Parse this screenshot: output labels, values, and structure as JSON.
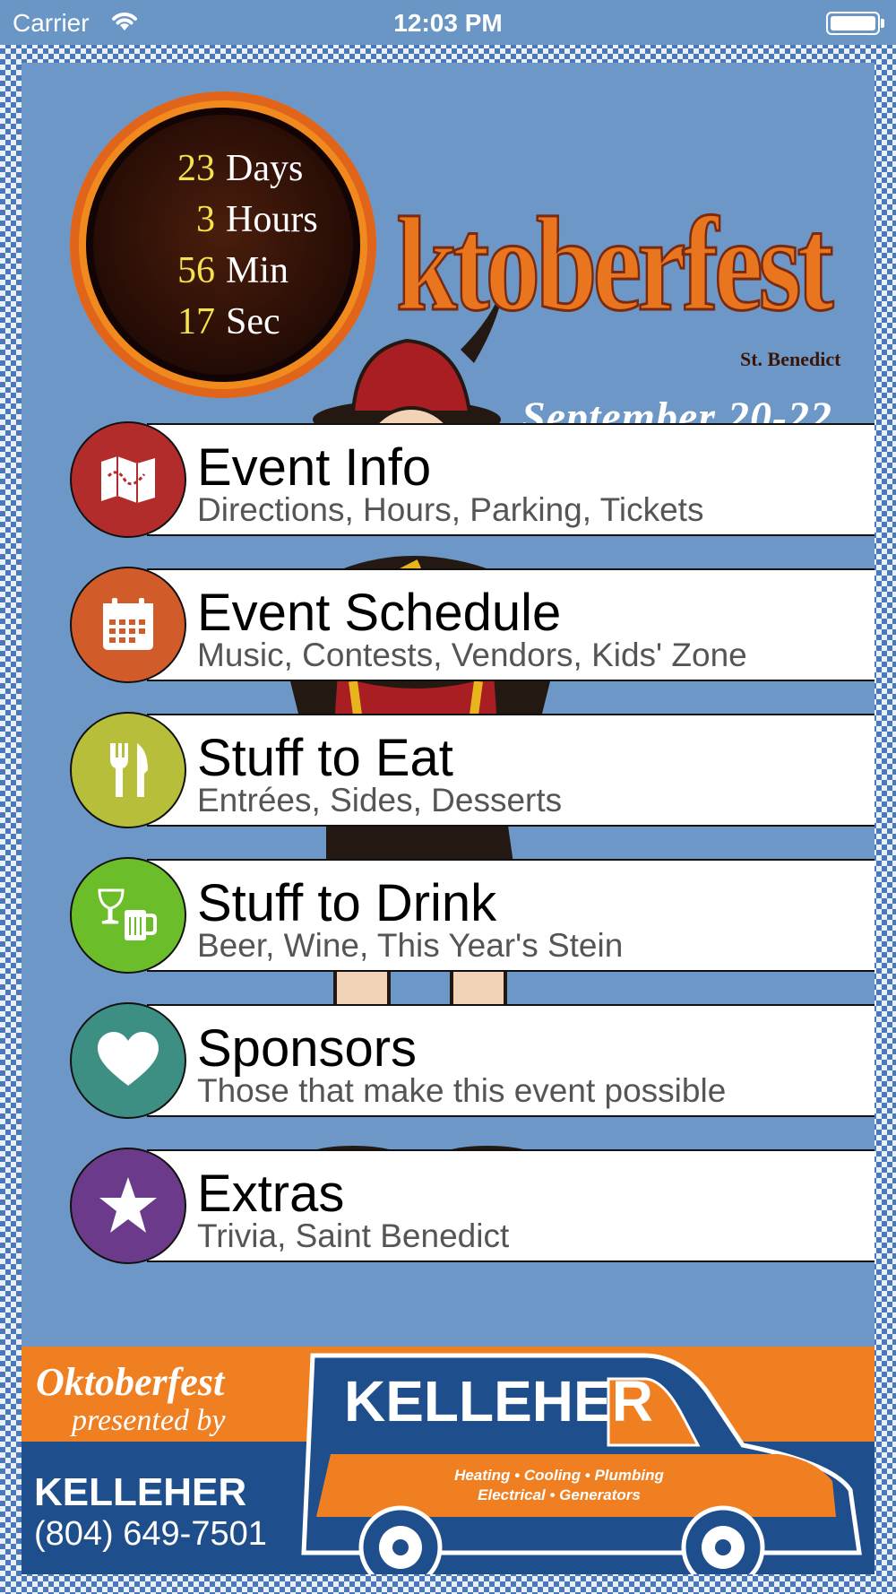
{
  "status_bar": {
    "carrier": "Carrier",
    "time": "12:03 PM",
    "icons": [
      "wifi-icon",
      "battery-icon"
    ]
  },
  "countdown": {
    "rows": [
      {
        "value": "23",
        "unit": "Days"
      },
      {
        "value": "3",
        "unit": "Hours"
      },
      {
        "value": "56",
        "unit": "Min"
      },
      {
        "value": "17",
        "unit": "Sec"
      }
    ]
  },
  "header": {
    "title": "ktoberfest",
    "subtitle": "St. Benedict",
    "dates": "September 20-22"
  },
  "menu": [
    {
      "label": "Event Info",
      "sub": "Directions, Hours, Parking, Tickets",
      "icon": "map-icon",
      "color": "#b32c2c"
    },
    {
      "label": "Event Schedule",
      "sub": "Music, Contests, Vendors, Kids' Zone",
      "icon": "calendar-icon",
      "color": "#d15c2a"
    },
    {
      "label": "Stuff to Eat",
      "sub": "Entrées, Sides, Desserts",
      "icon": "fork-knife-icon",
      "color": "#b7bf3a"
    },
    {
      "label": "Stuff to Drink",
      "sub": "Beer, Wine, This Year's Stein",
      "icon": "drinks-icon",
      "color": "#6cbd2a"
    },
    {
      "label": "Sponsors",
      "sub": "Those that make this event possible",
      "icon": "heart-icon",
      "color": "#3d8f84"
    },
    {
      "label": "Extras",
      "sub": "Trivia, Saint Benedict",
      "icon": "star-icon",
      "color": "#6b3a8a"
    }
  ],
  "banner": {
    "event": "Oktoberfest",
    "presented_by": "presented by",
    "sponsor": "KELLEHER",
    "phone": "(804) 649-7501",
    "van_name": "KELLEHER",
    "van_services_1": "Heating • Cooling • Plumbing",
    "van_services_2": "Electrical • Generators"
  },
  "colors": {
    "panel": "#6d97c6",
    "accent_orange": "#f07f22",
    "banner_blue": "#1f4e8c",
    "countdown_number": "#f4e34c"
  }
}
